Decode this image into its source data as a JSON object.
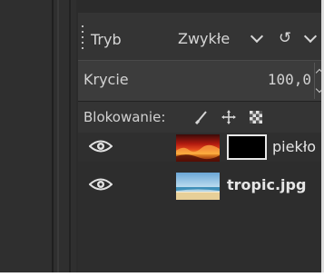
{
  "layers_panel": {
    "mode_label": "Tryb",
    "mode_value": "Zwykłe",
    "mode_extra_symbol": "↺",
    "opacity_label": "Krycie",
    "opacity_value": "100,0",
    "lock_label": "Blokowanie:",
    "layers": [
      {
        "name": "piekło"
      },
      {
        "name": "tropic.jpg"
      }
    ]
  },
  "colors": {
    "panel_bg": "#343434",
    "text": "#d6d6d6",
    "mask_border": "#e8e8e8"
  }
}
